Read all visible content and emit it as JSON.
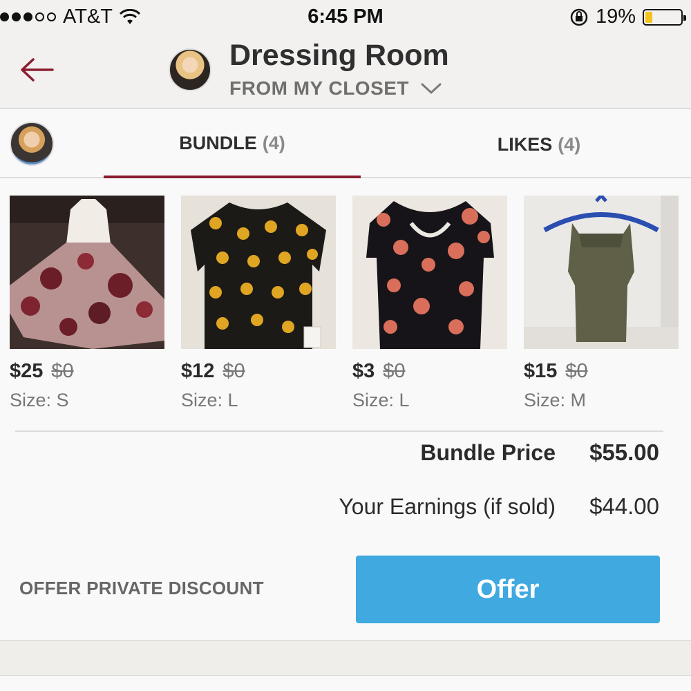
{
  "status_bar": {
    "carrier": "AT&T",
    "time": "6:45 PM",
    "battery_percent": "19%",
    "battery_level": 0.19,
    "signal_bars_filled": 3,
    "signal_bars_total": 5
  },
  "header": {
    "title": "Dressing Room",
    "subtitle": "FROM MY CLOSET"
  },
  "tabs": [
    {
      "label": "BUNDLE",
      "count": "(4)",
      "active": true
    },
    {
      "label": "LIKES",
      "count": "(4)",
      "active": false
    }
  ],
  "items": [
    {
      "price": "$25",
      "original_price": "$0",
      "size": "Size: S"
    },
    {
      "price": "$12",
      "original_price": "$0",
      "size": "Size: L"
    },
    {
      "price": "$3",
      "original_price": "$0",
      "size": "Size: L"
    },
    {
      "price": "$15",
      "original_price": "$0",
      "size": "Size: M"
    }
  ],
  "totals": {
    "bundle_price_label": "Bundle Price",
    "bundle_price_value": "$55.00",
    "earnings_label": "Your Earnings (if sold)",
    "earnings_value": "$44.00"
  },
  "actions": {
    "private_discount_label": "OFFER PRIVATE DISCOUNT",
    "offer_label": "Offer"
  },
  "colors": {
    "accent": "#8b1d2f",
    "offer_button": "#3fa9e0",
    "battery": "#f3c31c"
  }
}
